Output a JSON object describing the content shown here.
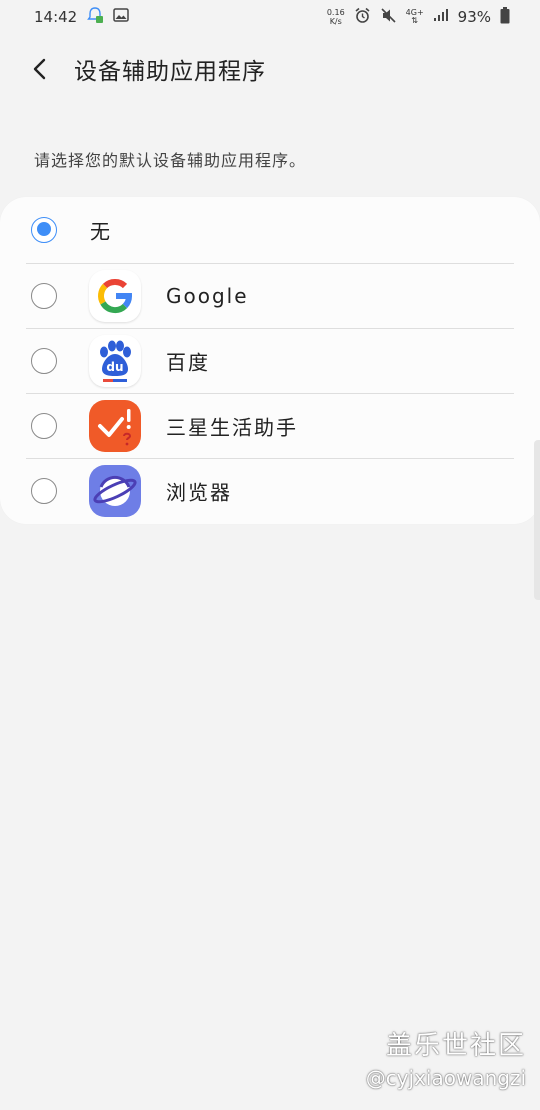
{
  "status_bar": {
    "time": "14:42",
    "net_speed_value": "0.16",
    "net_speed_unit": "K/s",
    "network_type": "4G+",
    "battery_percent": "93%"
  },
  "header": {
    "title": "设备辅助应用程序"
  },
  "description": "请选择您的默认设备辅助应用程序。",
  "options": [
    {
      "label": "无",
      "selected": true,
      "icon": null
    },
    {
      "label": "Google",
      "selected": false,
      "icon": "google-icon"
    },
    {
      "label": "百度",
      "selected": false,
      "icon": "baidu-icon"
    },
    {
      "label": "三星生活助手",
      "selected": false,
      "icon": "samsung-life-assistant-icon"
    },
    {
      "label": "浏览器",
      "selected": false,
      "icon": "samsung-browser-icon"
    }
  ],
  "icons": {
    "baidu_text": "du"
  },
  "colors": {
    "accent": "#3e8ef7",
    "background": "#f3f3f3",
    "card": "#fcfcfc"
  },
  "watermark": {
    "line1": "盖乐世社区",
    "line2": "@cyjxiaowangzi"
  }
}
